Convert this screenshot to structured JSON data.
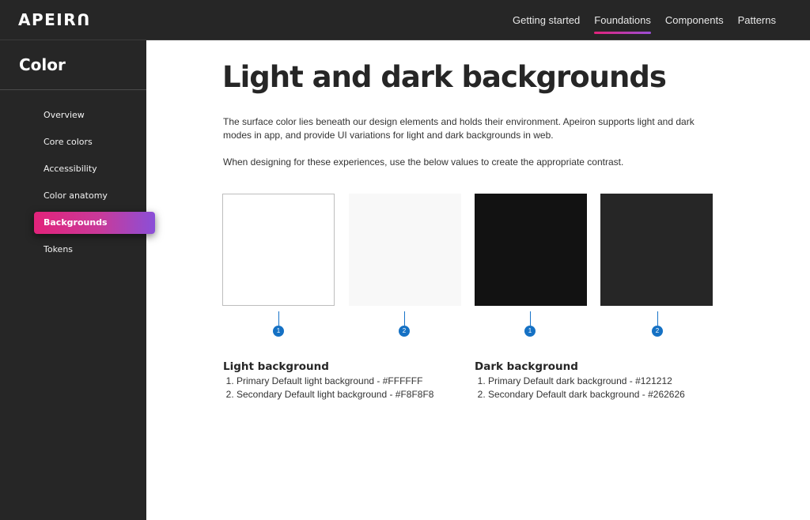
{
  "header": {
    "logo": "APEIRꓵ",
    "nav": [
      {
        "label": "Getting started"
      },
      {
        "label": "Foundations"
      },
      {
        "label": "Components"
      },
      {
        "label": "Patterns"
      }
    ]
  },
  "sidebar": {
    "title": "Color",
    "items": [
      {
        "label": "Overview"
      },
      {
        "label": "Core colors"
      },
      {
        "label": "Accessibility"
      },
      {
        "label": "Color anatomy"
      },
      {
        "label": "Backgrounds"
      },
      {
        "label": "Tokens"
      }
    ],
    "active_item": "Backgrounds"
  },
  "main": {
    "title": "Light and dark backgrounds",
    "intro": "The surface color lies beneath our design elements and holds their environment. Apeiron supports light and dark modes in app, and provide UI variations for light and dark backgrounds in web.",
    "instruction": "When designing for these experiences, use the below values to create the appropriate contrast.",
    "swatches": [
      {
        "color": "#FFFFFF",
        "marker": "1"
      },
      {
        "color": "#F8F8F8",
        "marker": "2"
      },
      {
        "color": "#121212",
        "marker": "1"
      },
      {
        "color": "#262626",
        "marker": "2"
      }
    ],
    "light": {
      "title": "Light background",
      "items": [
        "Primary Default light background - #FFFFFF",
        "Secondary Default light background - #F8F8F8"
      ]
    },
    "dark": {
      "title": "Dark background",
      "items": [
        "Primary Default dark background - #121212",
        "Secondary Default dark background - #262626"
      ]
    }
  },
  "colors": {
    "header_bg": "#262626",
    "sidebar_bg": "#262626",
    "accent_gradient_start": "#E2237B",
    "accent_gradient_end": "#8A4FD8",
    "marker_blue": "#1571C4"
  }
}
